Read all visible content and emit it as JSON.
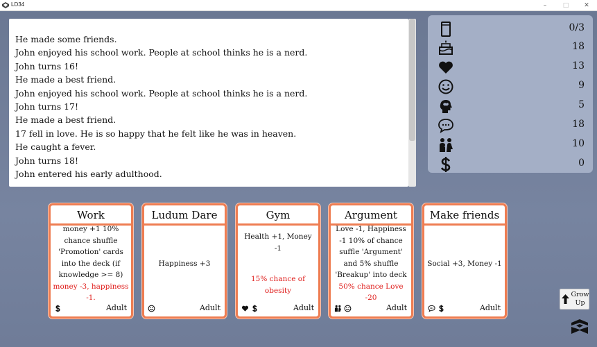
{
  "window": {
    "title": "LD34",
    "minimize": "–",
    "maximize": "□",
    "close": "✕"
  },
  "log": {
    "lines": [
      "He made some friends.",
      "John enjoyed his school work. People at school thinks he is a nerd.",
      "John turns 16!",
      "He made a best friend.",
      "John enjoyed his school work. People at school thinks he is a nerd.",
      "John turns 17!",
      "He made a best friend.",
      "17 fell in love. He is so happy that he felt like he was in heaven.",
      "He caught a fever.",
      "John turns 18!",
      "John entered his early adulthood."
    ]
  },
  "stats": [
    {
      "icon": "card-deck-icon",
      "value": "0/3"
    },
    {
      "icon": "birthday-cake-icon",
      "value": "18"
    },
    {
      "icon": "heart-icon",
      "value": "13"
    },
    {
      "icon": "smiley-face-icon",
      "value": "9"
    },
    {
      "icon": "brain-head-icon",
      "value": "5"
    },
    {
      "icon": "speech-bubble-icon",
      "value": "18"
    },
    {
      "icon": "couple-icon",
      "value": "10"
    },
    {
      "icon": "dollar-icon",
      "value": "0"
    }
  ],
  "cards": [
    {
      "title": "Work",
      "effect": "money +1 10% chance shuffle 'Promotion' cards into the deck (if knowledge >= 8)",
      "warning": "money -3, happiness -1.",
      "icons": [
        "dollar-icon"
      ],
      "age": "Adult"
    },
    {
      "title": "Ludum Dare",
      "effect": "Happiness +3",
      "warning": "",
      "icons": [
        "smiley-face-icon"
      ],
      "age": "Adult"
    },
    {
      "title": "Gym",
      "effect": "Health +1, Money -1",
      "warning": "15% chance of obesity",
      "icons": [
        "heart-icon",
        "dollar-icon"
      ],
      "age": "Adult"
    },
    {
      "title": "Argument",
      "effect": "Love -1, Happiness -1 10% of chance suffle 'Argument' and 5% shuffle 'Breakup' into deck",
      "warning": "50% chance Love -20",
      "icons": [
        "couple-icon",
        "smiley-face-icon"
      ],
      "age": "Adult"
    },
    {
      "title": "Make friends",
      "effect": "Social +3, Money -1",
      "warning": "",
      "icons": [
        "speech-bubble-icon",
        "dollar-icon"
      ],
      "age": "Adult"
    }
  ],
  "grow_button": {
    "line1": "Grow",
    "line2": "Up"
  },
  "logo": {
    "icon": "game-logo-icon"
  }
}
